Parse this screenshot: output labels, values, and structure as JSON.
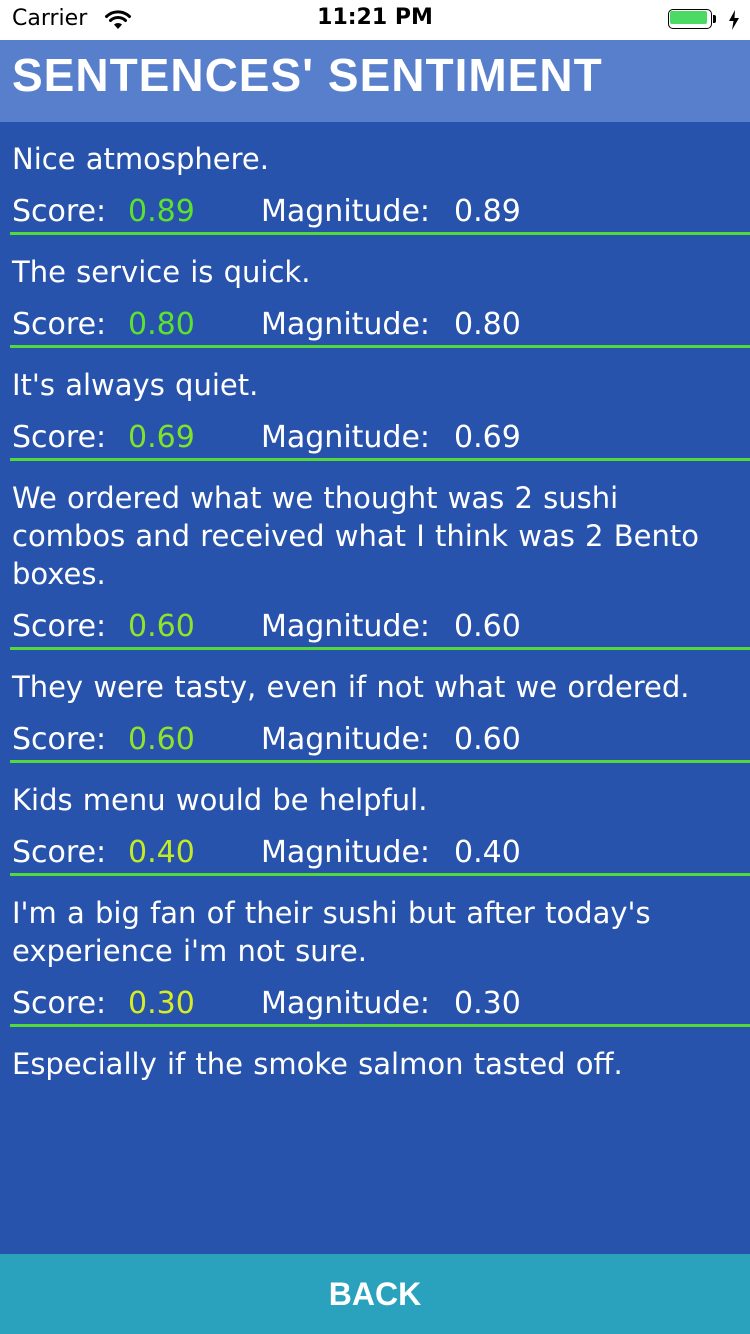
{
  "status_bar": {
    "carrier": "Carrier",
    "time": "11:21 PM",
    "battery_level": 0.9
  },
  "header": {
    "title": "SENTENCES' SENTIMENT"
  },
  "labels": {
    "score": "Score:",
    "magnitude": "Magnitude:"
  },
  "sentences": [
    {
      "text": "Nice atmosphere.",
      "score": "0.89",
      "magnitude": "0.89",
      "score_color": "#5de12f"
    },
    {
      "text": "The service is quick.",
      "score": "0.80",
      "magnitude": "0.80",
      "score_color": "#5de12f"
    },
    {
      "text": "It's always quiet.",
      "score": "0.69",
      "magnitude": "0.69",
      "score_color": "#7ee32a"
    },
    {
      "text": "We ordered what we thought was 2 sushi combos and received what I think was 2 Bento boxes.",
      "score": "0.60",
      "magnitude": "0.60",
      "score_color": "#8fe42a"
    },
    {
      "text": "They were tasty, even if not what we ordered.",
      "score": "0.60",
      "magnitude": "0.60",
      "score_color": "#8fe42a"
    },
    {
      "text": "Kids menu would be helpful.",
      "score": "0.40",
      "magnitude": "0.40",
      "score_color": "#c2ea26"
    },
    {
      "text": "I'm a big fan of their sushi but after today's experience i'm not sure.",
      "score": "0.30",
      "magnitude": "0.30",
      "score_color": "#d6ec24"
    },
    {
      "text": "Especially if the smoke salmon tasted off.",
      "score": "",
      "magnitude": "",
      "score_color": "#d6ec24"
    }
  ],
  "footer": {
    "back_label": "BACK"
  },
  "colors": {
    "background": "#2853ad",
    "header": "#587fcb",
    "divider": "#53d93a",
    "back_button": "#2aa2bd"
  }
}
